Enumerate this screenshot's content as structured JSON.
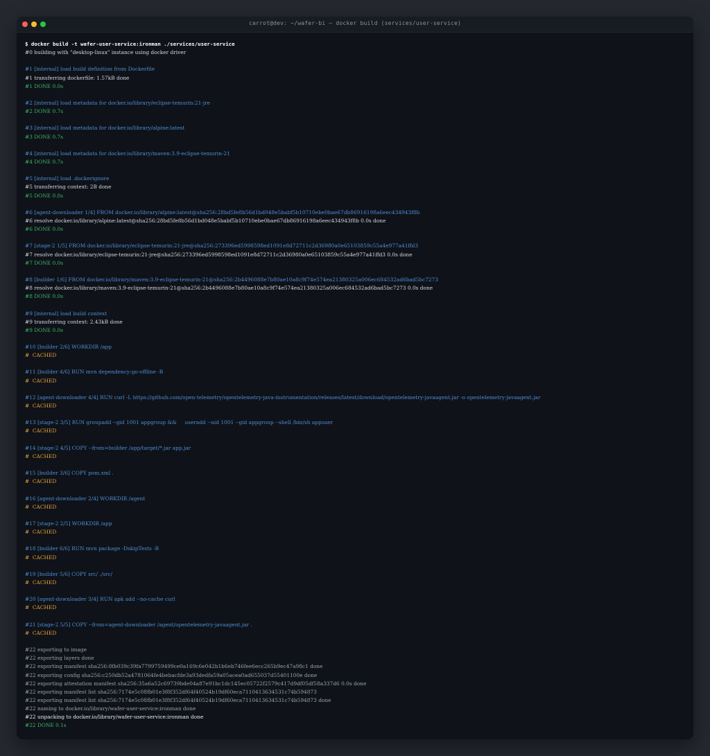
{
  "window": {
    "title": "carrot@dev: ~/wafer-bi — docker build (services/user-service)"
  },
  "colors": {
    "command": "#ffffff",
    "text": "#d4d9e2",
    "step": "#4d8fd8",
    "done": "#3bb86a",
    "cached": "#e6a23c",
    "export": "#9aa2b0"
  },
  "lines": [
    {
      "t": "$ docker build -t wafer-user-service:ironman ./services/user-service",
      "c": "cmd"
    },
    {
      "t": "#0 building with \"desktop-linux\" instance using docker driver",
      "c": "c-white"
    },
    {
      "t": "",
      "c": "c-white"
    },
    {
      "t": "#1 [internal] load build definition from Dockerfile",
      "c": "c-blue"
    },
    {
      "t": "#1 transferring dockerfile: 1.57kB done",
      "c": "c-white"
    },
    {
      "t": "#1 DONE 0.0s",
      "c": "c-green"
    },
    {
      "t": "",
      "c": "c-white"
    },
    {
      "t": "#2 [internal] load metadata for docker.io/library/eclipse-temurin:21-jre",
      "c": "c-blue"
    },
    {
      "t": "#2 DONE 0.7s",
      "c": "c-green"
    },
    {
      "t": "",
      "c": "c-white"
    },
    {
      "t": "#3 [internal] load metadata for docker.io/library/alpine:latest",
      "c": "c-blue"
    },
    {
      "t": "#3 DONE 0.7s",
      "c": "c-green"
    },
    {
      "t": "",
      "c": "c-white"
    },
    {
      "t": "#4 [internal] load metadata for docker.io/library/maven:3.9-eclipse-temurin-21",
      "c": "c-blue"
    },
    {
      "t": "#4 DONE 0.7s",
      "c": "c-green"
    },
    {
      "t": "",
      "c": "c-white"
    },
    {
      "t": "#5 [internal] load .dockerignore",
      "c": "c-blue"
    },
    {
      "t": "#5 transferring context: 2B done",
      "c": "c-white"
    },
    {
      "t": "#5 DONE 0.0s",
      "c": "c-green"
    },
    {
      "t": "",
      "c": "c-white"
    },
    {
      "t": "#6 [agent-downloader 1/4] FROM docker.io/library/alpine:latest@sha256:28bd5fe8b56d1bd048e5babf5b10710ebe0bae67db86916198a6eec434943f8b",
      "c": "c-blue"
    },
    {
      "t": "#6 resolve docker.io/library/alpine:latest@sha256:28bd5fe8b56d1bd048e5babf5b10710ebe0bae67db86916198a6eec434943f8b 0.0s done",
      "c": "c-white"
    },
    {
      "t": "#6 DONE 0.0s",
      "c": "c-green"
    },
    {
      "t": "",
      "c": "c-white"
    },
    {
      "t": "#7 [stage-2 1/5] FROM docker.io/library/eclipse-temurin:21-jre@sha256:273396ed5998598ed1091e8d72711c2d36980a0e65103859c55a4e977a41ffd3",
      "c": "c-blue"
    },
    {
      "t": "#7 resolve docker.io/library/eclipse-temurin:21-jre@sha256:273396ed5998598ed1091e8d72711c2d36980a0e65103859c55a4e977a41ffd3 0.0s done",
      "c": "c-white"
    },
    {
      "t": "#7 DONE 0.0s",
      "c": "c-green"
    },
    {
      "t": "",
      "c": "c-white"
    },
    {
      "t": "#8 [builder 1/6] FROM docker.io/library/maven:3.9-eclipse-temurin-21@sha256:2b4496088e7b80ae10a8c9f74e574ea21380325a006ec684532ad6bad5bc7273",
      "c": "c-blue"
    },
    {
      "t": "#8 resolve docker.io/library/maven:3.9-eclipse-temurin-21@sha256:2b4496088e7b80ae10a8c9f74e574ea21380325a006ec684532ad6bad5bc7273 0.0s done",
      "c": "c-white"
    },
    {
      "t": "#8 DONE 0.0s",
      "c": "c-green"
    },
    {
      "t": "",
      "c": "c-white"
    },
    {
      "t": "#9 [internal] load build context",
      "c": "c-blue"
    },
    {
      "t": "#9 transferring context: 2.43kB done",
      "c": "c-white"
    },
    {
      "t": "#9 DONE 0.0s",
      "c": "c-green"
    },
    {
      "t": "",
      "c": "c-white"
    },
    {
      "t": "#10 [builder 2/6] WORKDIR /app",
      "c": "c-blue"
    },
    {
      "t": "#  CACHED",
      "c": "c-orange"
    },
    {
      "t": "",
      "c": "c-white"
    },
    {
      "t": "#11 [builder 4/6] RUN mvn dependency:go-offline -B",
      "c": "c-blue"
    },
    {
      "t": "#  CACHED",
      "c": "c-orange"
    },
    {
      "t": "",
      "c": "c-white"
    },
    {
      "t": "#12 [agent-downloader 4/4] RUN curl -L https://github.com/open-telemetry/opentelemetry-java-instrumentation/releases/latest/download/opentelemetry-javaagent.jar -o opentelemetry-javaagent.jar",
      "c": "c-blue"
    },
    {
      "t": "#  CACHED",
      "c": "c-orange"
    },
    {
      "t": "",
      "c": "c-white"
    },
    {
      "t": "#13 [stage-2 3/5] RUN groupadd --gid 1001 appgroup &&     useradd --uid 1001 --gid appgroup --shell /bin/sh appuser",
      "c": "c-blue"
    },
    {
      "t": "#  CACHED",
      "c": "c-orange"
    },
    {
      "t": "",
      "c": "c-white"
    },
    {
      "t": "#14 [stage-2 4/5] COPY --from=builder /app/target/*.jar app.jar",
      "c": "c-blue"
    },
    {
      "t": "#  CACHED",
      "c": "c-orange"
    },
    {
      "t": "",
      "c": "c-white"
    },
    {
      "t": "#15 [builder 3/6] COPY pom.xml .",
      "c": "c-blue"
    },
    {
      "t": "#  CACHED",
      "c": "c-orange"
    },
    {
      "t": "",
      "c": "c-white"
    },
    {
      "t": "#16 [agent-downloader 2/4] WORKDIR /agent",
      "c": "c-blue"
    },
    {
      "t": "#  CACHED",
      "c": "c-orange"
    },
    {
      "t": "",
      "c": "c-white"
    },
    {
      "t": "#17 [stage-2 2/5] WORKDIR /app",
      "c": "c-blue"
    },
    {
      "t": "#  CACHED",
      "c": "c-orange"
    },
    {
      "t": "",
      "c": "c-white"
    },
    {
      "t": "#18 [builder 6/6] RUN mvn package -DskipTests -B",
      "c": "c-blue"
    },
    {
      "t": "#  CACHED",
      "c": "c-orange"
    },
    {
      "t": "",
      "c": "c-white"
    },
    {
      "t": "#19 [builder 5/6] COPY src/ ./src/",
      "c": "c-blue"
    },
    {
      "t": "#  CACHED",
      "c": "c-orange"
    },
    {
      "t": "",
      "c": "c-white"
    },
    {
      "t": "#20 [agent-downloader 3/4] RUN apk add --no-cache curl",
      "c": "c-blue"
    },
    {
      "t": "#  CACHED",
      "c": "c-orange"
    },
    {
      "t": "",
      "c": "c-white"
    },
    {
      "t": "#21 [stage-2 5/5] COPY --from=agent-downloader /agent/opentelemetry-javaagent.jar .",
      "c": "c-blue"
    },
    {
      "t": "#  CACHED",
      "c": "c-orange"
    },
    {
      "t": "",
      "c": "c-white"
    },
    {
      "t": "#22 exporting to image",
      "c": "c-gray"
    },
    {
      "t": "#22 exporting layers done",
      "c": "c-gray"
    },
    {
      "t": "#22 exporting manifest sha256:8fb039c39fa7799759499ce0a169c6e042b1b6eb746fee6ecc265b9ec47a98c1 done",
      "c": "c-gray"
    },
    {
      "t": "#22 exporting config sha256:c250db52a4781064fe4bebacfde3a93dedfa59a05acea0ad655037d55401100e done",
      "c": "c-gray"
    },
    {
      "t": "#22 exporting attestation manifest sha256:35a6a52c69739bde04a87e91bc1dc145ec05722f2579c417d9df05df58a337d6 0.0s done",
      "c": "c-gray"
    },
    {
      "t": "#22 exporting manifest list sha256:7174e5c08fb01e3f8f352df64f40524b19df60eca7110413634531c74b594873",
      "c": "c-gray"
    },
    {
      "t": "#22 exporting manifest list sha256:7174e5c08fb01e3f8f352df64f40524b19df60eca7110413634531c74b594873 done",
      "c": "c-gray"
    },
    {
      "t": "#22 naming to docker.io/library/wafer-user-service:ironman done",
      "c": "c-gray"
    },
    {
      "t": "#22 unpacking to docker.io/library/wafer-user-service:ironman done",
      "c": "c-bright"
    },
    {
      "t": "#22 DONE 0.1s",
      "c": "c-green"
    }
  ]
}
